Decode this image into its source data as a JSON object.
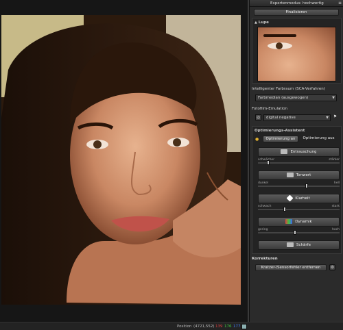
{
  "panel": {
    "title": "Expertenmodus: hochwertig",
    "finalize_label": "Finalisieren",
    "loupe_label": "Lupe",
    "color_space": {
      "title": "Intelligenter Farbraum (SCA-Verfahren)",
      "selected": "Farbmedian (ausgewogen)"
    },
    "film": {
      "title": "Fotofilm-Emulation",
      "selected": "digital negative"
    },
    "assistant": {
      "title": "Optimierungs-Assistent",
      "on_label": "Optimierung an",
      "off_label": "Optimierung aus",
      "entrauschung": {
        "label": "Entrauschung",
        "min": "schwächer",
        "max": "stärker",
        "level": 0.13
      },
      "tonwert": {
        "label": "Tonwert",
        "min": "dunkel",
        "max": "hell",
        "level": 0.6
      },
      "klarheit": {
        "label": "Klarheit",
        "min": "schwach",
        "max": "stark",
        "level": 0.33
      },
      "dynamik": {
        "label": "Dynamik",
        "min": "gering",
        "max": "hoch",
        "level": 0.45
      },
      "schaerfe": {
        "label": "Schärfe"
      }
    },
    "corrections": {
      "title": "Korrekturen",
      "button_label": "Kratzer-/Sensorfehler entfernen"
    }
  },
  "status": {
    "position_label": "Position",
    "coords": "(4721,552)",
    "r": "139",
    "g": "176",
    "b": "177"
  },
  "colors": {
    "status_r": "#e04040",
    "status_g": "#40d040",
    "status_b": "#4080ff"
  }
}
